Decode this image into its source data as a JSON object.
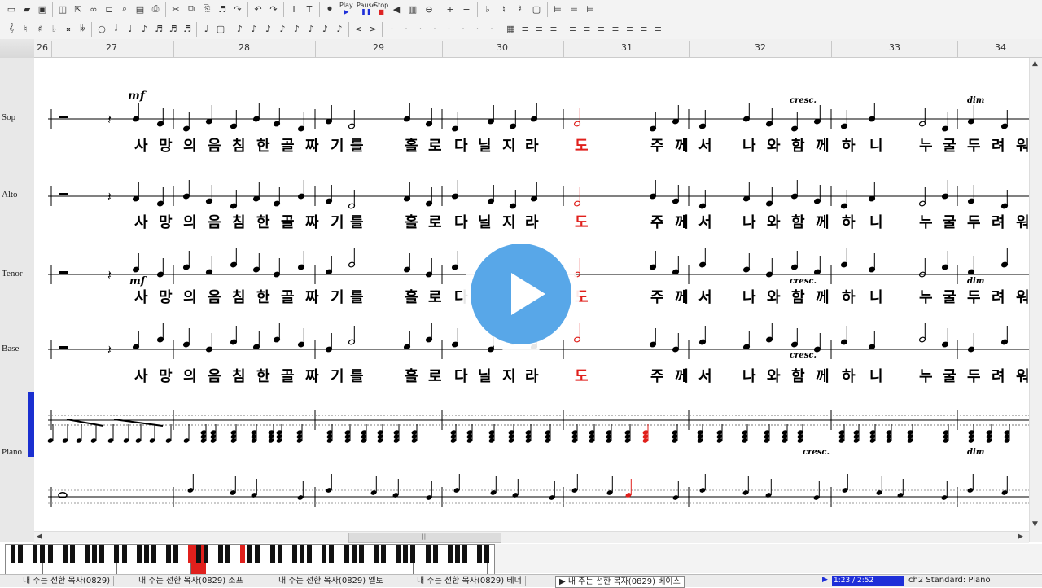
{
  "toolbar": {
    "play_label": "Play",
    "pause_label": "Pause",
    "stop_label": "Stop"
  },
  "ruler": {
    "measures": [
      "26",
      "27",
      "28",
      "29",
      "30",
      "31",
      "32",
      "33",
      "34"
    ]
  },
  "parts": [
    "Sop",
    "Alto",
    "Tenor",
    "Base",
    "Piano"
  ],
  "dynamics": {
    "mf": "mf",
    "cresc": "cresc.",
    "dim": "dim"
  },
  "lyrics": [
    "사",
    "망",
    "의",
    "음",
    "침",
    "한",
    "골",
    "짜",
    "기",
    "를",
    "홀",
    "로",
    "다",
    "닐",
    "지",
    "라",
    "도",
    "주",
    "께",
    "서",
    "나",
    "와",
    "함",
    "께",
    "하",
    "니",
    "누",
    "굴",
    "두",
    "려",
    "워"
  ],
  "lyric_highlight_index": 16,
  "lyric_highlight_color": "#e0201c",
  "accent_color": "#1e2fd8",
  "status": {
    "tabs": [
      "내 주는 선한 목자(0829)",
      "내 주는 선한 목자(0829) 소프",
      "내 주는 선한 목자(0829) 엘토",
      "내 주는 선한 목자(0829) 테너",
      "▶ 내 주는 선한 목자(0829) 베이스"
    ],
    "time": "1:23 / 2:52",
    "instrument": "ch2 Standard: Piano"
  }
}
